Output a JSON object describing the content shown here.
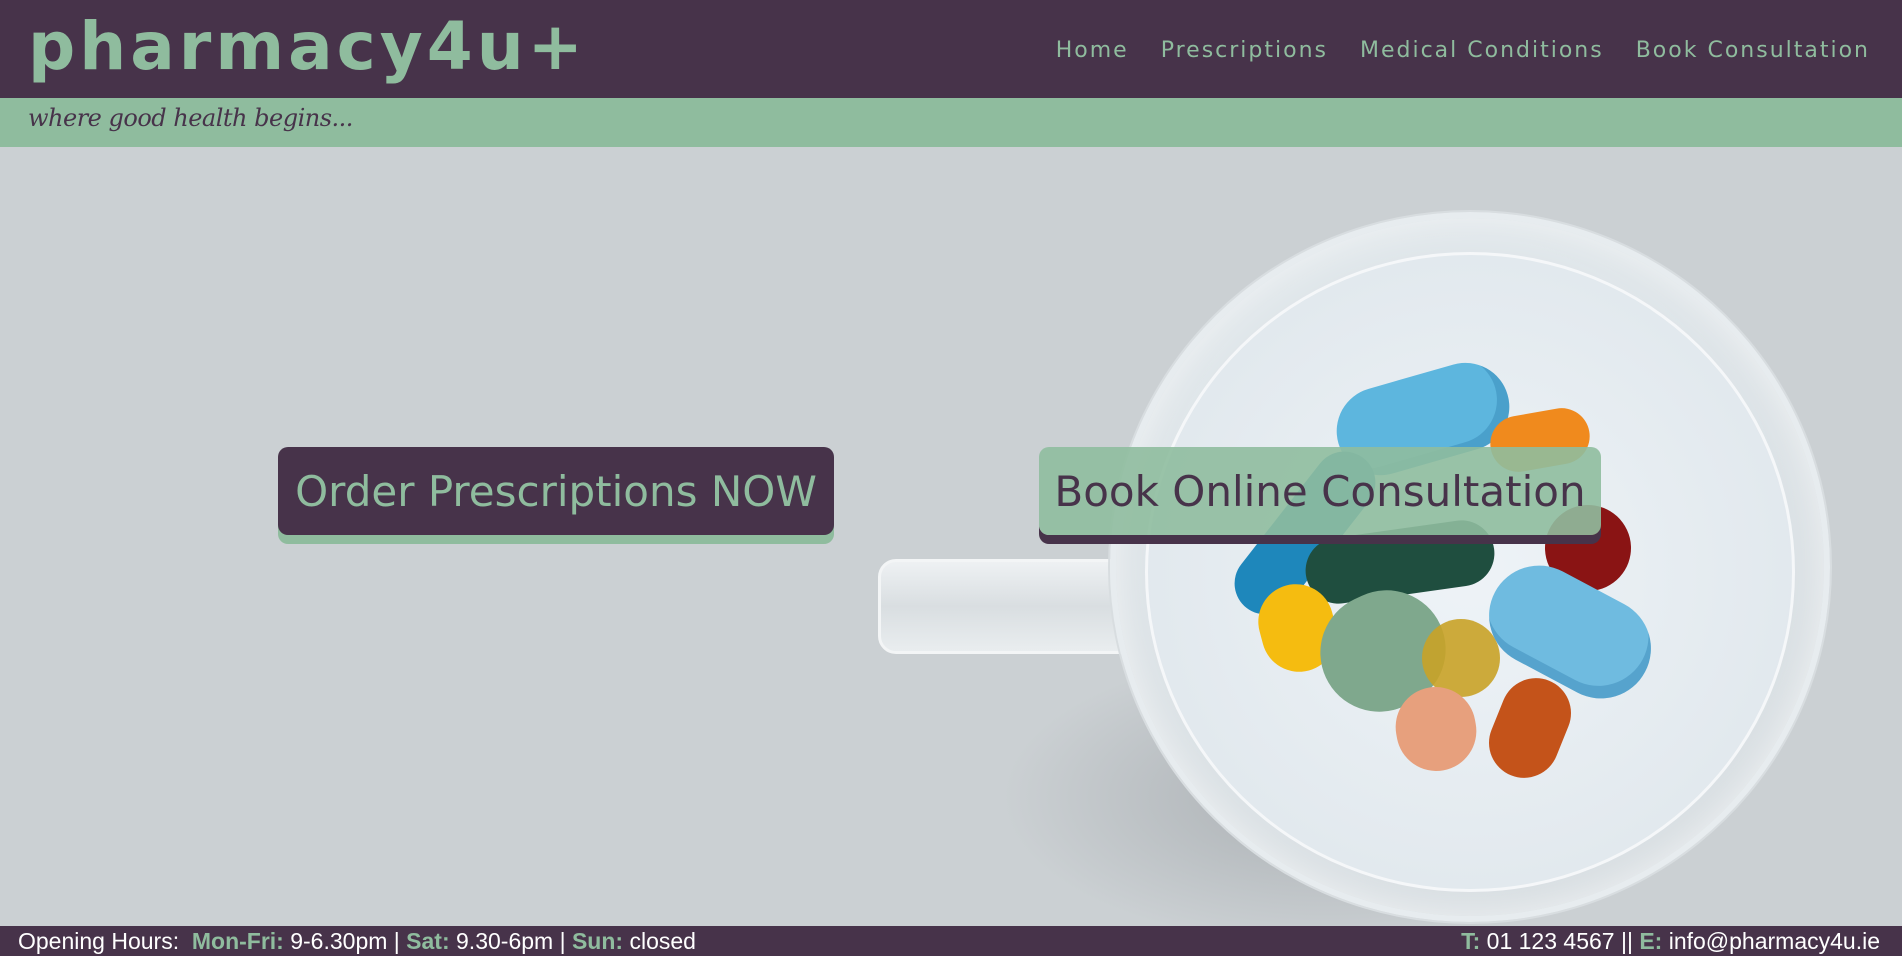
{
  "brand": {
    "logo": "pharmacy4u+",
    "tagline": "where good health begins..."
  },
  "nav": {
    "items": [
      {
        "label": "Home"
      },
      {
        "label": "Prescriptions"
      },
      {
        "label": "Medical Conditions"
      },
      {
        "label": "Book Consultation"
      }
    ]
  },
  "hero": {
    "order_button": "Order Prescriptions NOW",
    "consult_button": "Book Online Consultation",
    "image": "glass-cup-of-pills"
  },
  "footer": {
    "hours_label": "Opening Hours:",
    "weekday_label": "Mon-Fri:",
    "weekday_hours": "9-6.30pm",
    "sep1": "|",
    "sat_label": "Sat:",
    "sat_hours": "9.30-6pm",
    "sep2": "|",
    "sun_label": "Sun:",
    "sun_hours": "closed",
    "phone_label": "T:",
    "phone": "01 123 4567",
    "contact_sep": "||",
    "email_label": "E:",
    "email": "info@pharmacy4u.ie"
  },
  "colors": {
    "primary": "#47334a",
    "accent": "#8fbc9e",
    "background": "#cbd0d3"
  }
}
